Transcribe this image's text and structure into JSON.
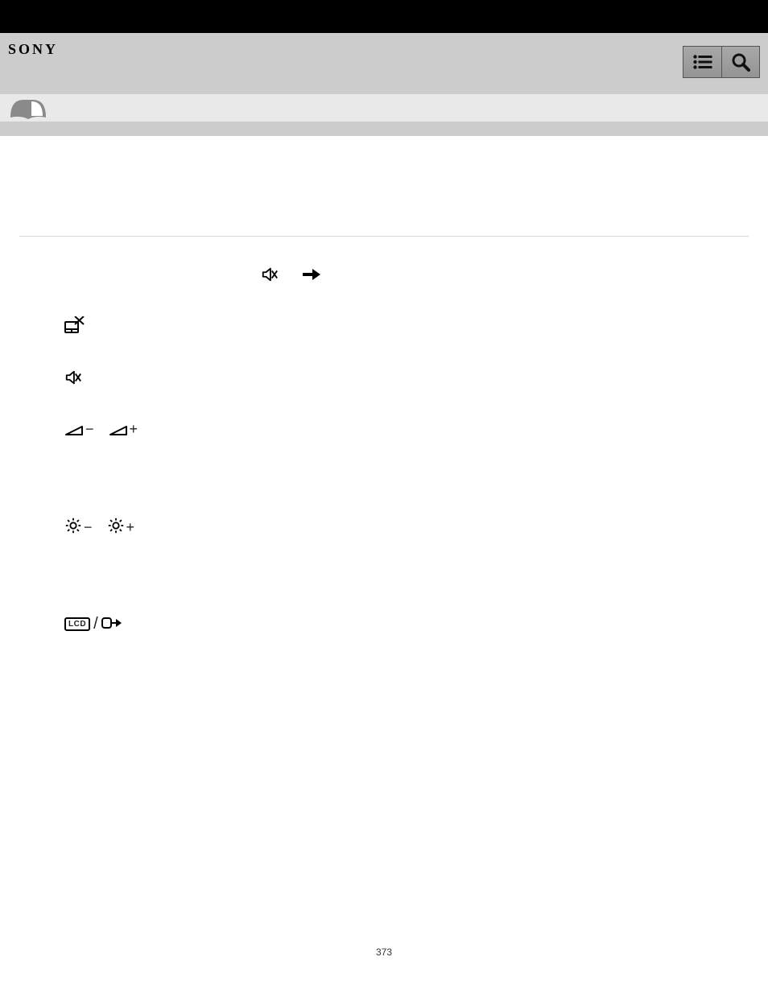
{
  "header": {
    "brand": "SONY"
  },
  "icons": {
    "list_button": "list-icon",
    "search_button": "search-icon",
    "book_icon": "book-icon"
  },
  "rows": {
    "mute_arrow": {
      "mute": "mute-icon",
      "arrow": "arrow-right-icon"
    },
    "touchpad_off": {
      "icon": "touchpad-off-icon"
    },
    "mute": {
      "icon": "mute-icon"
    },
    "volume": {
      "minus": "−",
      "plus": "+"
    },
    "brightness": {
      "minus": "−",
      "plus": "+"
    },
    "display": {
      "label": "LCD",
      "slash": "/"
    }
  },
  "page_number": "373"
}
